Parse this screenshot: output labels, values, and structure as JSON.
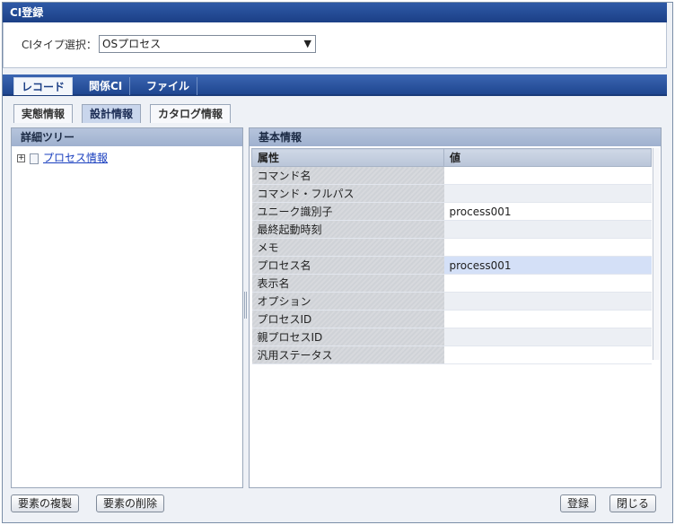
{
  "window": {
    "title": "CI登録"
  },
  "ci_type": {
    "label": "CIタイプ選択：",
    "selected": "OSプロセス"
  },
  "main_tabs": [
    "レコード",
    "関係CI",
    "ファイル"
  ],
  "sub_tabs": [
    "実態情報",
    "設計情報",
    "カタログ情報"
  ],
  "tree": {
    "title": "詳細ツリー",
    "items": [
      "プロセス情報"
    ]
  },
  "basic_info": {
    "title": "基本情報",
    "columns": [
      "属性",
      "値"
    ],
    "rows": [
      {
        "attr": "コマンド名",
        "value": ""
      },
      {
        "attr": "コマンド・フルパス",
        "value": ""
      },
      {
        "attr": "ユニーク識別子",
        "value": "process001"
      },
      {
        "attr": "最終起動時刻",
        "value": ""
      },
      {
        "attr": "メモ",
        "value": ""
      },
      {
        "attr": "プロセス名",
        "value": "process001"
      },
      {
        "attr": "表示名",
        "value": ""
      },
      {
        "attr": "オプション",
        "value": ""
      },
      {
        "attr": "プロセスID",
        "value": ""
      },
      {
        "attr": "親プロセスID",
        "value": ""
      },
      {
        "attr": "汎用ステータス",
        "value": ""
      }
    ]
  },
  "buttons": {
    "copy": "要素の複製",
    "delete": "要素の削除",
    "register": "登録",
    "close": "閉じる"
  },
  "colors": {
    "titlebar": "#1b3f86",
    "link": "#1a3fbf",
    "selected_row": "#d4e0f7"
  }
}
